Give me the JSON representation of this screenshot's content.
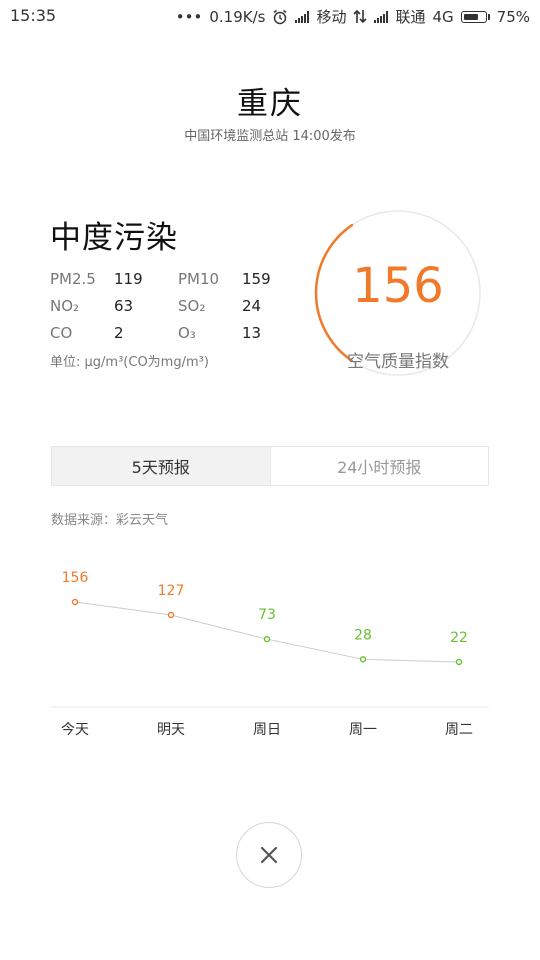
{
  "status_bar": {
    "time": "15:35",
    "dots": "•••",
    "speed": "0.19K/s",
    "carrier1": "移动",
    "carrier2": "联通",
    "network": "4G",
    "battery_level": 0.75,
    "battery": "75%",
    "icons": [
      "alarm-icon",
      "signal-icon",
      "data-arrows-icon",
      "signal-icon",
      "battery-icon"
    ]
  },
  "header": {
    "city": "重庆",
    "subtitle": "中国环境监测总站 14:00发布"
  },
  "pollution": {
    "level": "中度污染",
    "items": [
      {
        "label": "PM2.5",
        "value": "119"
      },
      {
        "label": "PM10",
        "value": "159"
      },
      {
        "label": "NO₂",
        "value": "63"
      },
      {
        "label": "SO₂",
        "value": "24"
      },
      {
        "label": "CO",
        "value": "2"
      },
      {
        "label": "O₃",
        "value": "13"
      }
    ],
    "unit": "单位: μg/m³(CO为mg/m³)"
  },
  "gauge": {
    "value": "156",
    "label": "空气质量指数",
    "level_fraction": 0.31,
    "accent_color": "#f07a2a",
    "track_color": "#e8e8e8"
  },
  "tabs": [
    {
      "label": "5天预报",
      "active": true
    },
    {
      "label": "24小时预报",
      "active": false
    }
  ],
  "source": "数据来源：彩云天气",
  "chart_data": {
    "type": "line",
    "categories": [
      "今天",
      "明天",
      "周日",
      "周一",
      "周二"
    ],
    "values": [
      156,
      127,
      73,
      28,
      22
    ],
    "colors": [
      "#f07a2a",
      "#f07a2a",
      "#6abf2e",
      "#6abf2e",
      "#6abf2e"
    ],
    "line_color": "#cccccc"
  },
  "close_icon": "close-icon"
}
